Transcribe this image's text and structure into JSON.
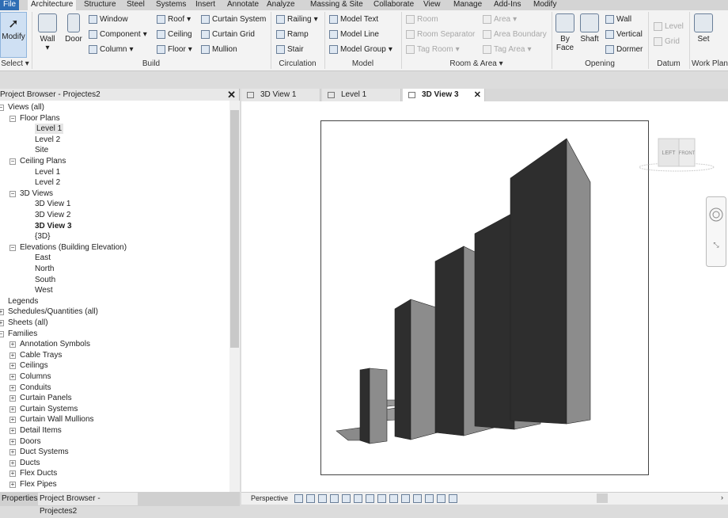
{
  "menu_tabs": [
    "File",
    "Architecture",
    "Structure",
    "Steel",
    "Systems",
    "Insert",
    "Annotate",
    "Analyze",
    "Massing & Site",
    "Collaborate",
    "View",
    "Manage",
    "Add-Ins",
    "Modify"
  ],
  "active_tab": "Architecture",
  "ribbon": {
    "select": {
      "modify": "Modify",
      "panel": "Select ▾"
    },
    "build": {
      "wall": "Wall",
      "door": "Door",
      "window": "Window",
      "component": "Component",
      "column": "Column",
      "roof": "Roof",
      "ceiling": "Ceiling",
      "floor": "Floor",
      "curtain_system": "Curtain System",
      "curtain_grid": "Curtain Grid",
      "mullion": "Mullion",
      "panel": "Build"
    },
    "circulation": {
      "railing": "Railing",
      "ramp": "Ramp",
      "stair": "Stair",
      "panel": "Circulation"
    },
    "model": {
      "text": "Model Text",
      "line": "Model Line",
      "group": "Model Group",
      "panel": "Model"
    },
    "room_area": {
      "room": "Room",
      "room_separator": "Room Separator",
      "tag_room": "Tag Room",
      "area": "Area",
      "area_boundary": "Area Boundary",
      "tag_area": "Tag Area",
      "panel": "Room & Area ▾"
    },
    "opening": {
      "by_face": "By Face",
      "shaft": "Shaft",
      "wall": "Wall",
      "vertical": "Vertical",
      "dormer": "Dormer",
      "panel": "Opening"
    },
    "datum": {
      "level": "Level",
      "grid": "Grid",
      "panel": "Datum"
    },
    "work_plane": {
      "set": "Set",
      "panel": "Work Plane"
    }
  },
  "project_browser": {
    "title": "Project Browser - Projectes2",
    "tree": [
      {
        "label": "Views (all)",
        "level": 0,
        "exp": "−"
      },
      {
        "label": "Floor Plans",
        "level": 1,
        "exp": "−"
      },
      {
        "label": "Level 1",
        "level": 2,
        "selected": true
      },
      {
        "label": "Level 2",
        "level": 2
      },
      {
        "label": "Site",
        "level": 2
      },
      {
        "label": "Ceiling Plans",
        "level": 1,
        "exp": "−"
      },
      {
        "label": "Level 1",
        "level": 2
      },
      {
        "label": "Level 2",
        "level": 2
      },
      {
        "label": "3D Views",
        "level": 1,
        "exp": "−"
      },
      {
        "label": "3D View 1",
        "level": 2
      },
      {
        "label": "3D View 2",
        "level": 2
      },
      {
        "label": "3D View 3",
        "level": 2,
        "bold": true
      },
      {
        "label": "{3D}",
        "level": 2
      },
      {
        "label": "Elevations (Building Elevation)",
        "level": 1,
        "exp": "−"
      },
      {
        "label": "East",
        "level": 2
      },
      {
        "label": "North",
        "level": 2
      },
      {
        "label": "South",
        "level": 2
      },
      {
        "label": "West",
        "level": 2
      },
      {
        "label": "Legends",
        "level": 0
      },
      {
        "label": "Schedules/Quantities (all)",
        "level": 0,
        "exp": "+"
      },
      {
        "label": "Sheets (all)",
        "level": 0,
        "exp": "+"
      },
      {
        "label": "Families",
        "level": 0,
        "exp": "−"
      },
      {
        "label": "Annotation Symbols",
        "level": 1,
        "exp": "+"
      },
      {
        "label": "Cable Trays",
        "level": 1,
        "exp": "+"
      },
      {
        "label": "Ceilings",
        "level": 1,
        "exp": "+"
      },
      {
        "label": "Columns",
        "level": 1,
        "exp": "+"
      },
      {
        "label": "Conduits",
        "level": 1,
        "exp": "+"
      },
      {
        "label": "Curtain Panels",
        "level": 1,
        "exp": "+"
      },
      {
        "label": "Curtain Systems",
        "level": 1,
        "exp": "+"
      },
      {
        "label": "Curtain Wall Mullions",
        "level": 1,
        "exp": "+"
      },
      {
        "label": "Detail Items",
        "level": 1,
        "exp": "+"
      },
      {
        "label": "Doors",
        "level": 1,
        "exp": "+"
      },
      {
        "label": "Duct Systems",
        "level": 1,
        "exp": "+"
      },
      {
        "label": "Ducts",
        "level": 1,
        "exp": "+"
      },
      {
        "label": "Flex Ducts",
        "level": 1,
        "exp": "+"
      },
      {
        "label": "Flex Pipes",
        "level": 1,
        "exp": "+"
      }
    ]
  },
  "bottom_tabs": [
    "Properties",
    "Project Browser - Projectes2"
  ],
  "view_tabs": [
    {
      "label": "3D View 1"
    },
    {
      "label": "Level 1"
    },
    {
      "label": "3D View 3",
      "active": true
    }
  ],
  "viewcube": {
    "left": "LEFT",
    "front": "FRONT"
  },
  "status": {
    "view_mode": "Perspective"
  }
}
